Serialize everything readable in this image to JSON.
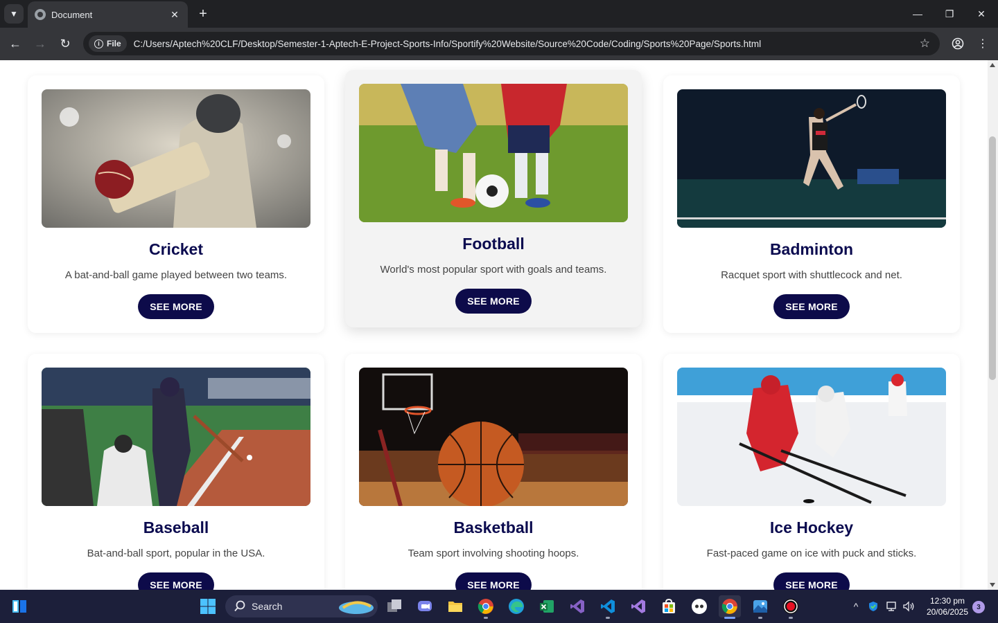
{
  "browser": {
    "tab_title": "Document",
    "scheme_chip": "File",
    "url": "C:/Users/Aptech%20CLF/Desktop/Semester-1-Aptech-E-Project-Sports-Info/Sportify%20Website/Source%20Code/Coding/Sports%20Page/Sports.html"
  },
  "sports": [
    {
      "title": "Cricket",
      "desc": "A bat-and-ball game played between two teams.",
      "button": "SEE MORE"
    },
    {
      "title": "Football",
      "desc": "World's most popular sport with goals and teams.",
      "button": "SEE MORE"
    },
    {
      "title": "Badminton",
      "desc": "Racquet sport with shuttlecock and net.",
      "button": "SEE MORE"
    },
    {
      "title": "Baseball",
      "desc": "Bat-and-ball sport, popular in the USA.",
      "button": "SEE MORE"
    },
    {
      "title": "Basketball",
      "desc": "Team sport involving shooting hoops.",
      "button": "SEE MORE"
    },
    {
      "title": "Ice Hockey",
      "desc": "Fast-paced game on ice with puck and sticks.",
      "button": "SEE MORE"
    }
  ],
  "taskbar": {
    "search_label": "Search",
    "time": "12:30 pm",
    "date": "20/06/2025",
    "notification_count": "3"
  },
  "colors": {
    "title": "#0b0b4f",
    "button_bg": "#0d0b4a",
    "taskbar_bg": "#1c1f3a"
  }
}
